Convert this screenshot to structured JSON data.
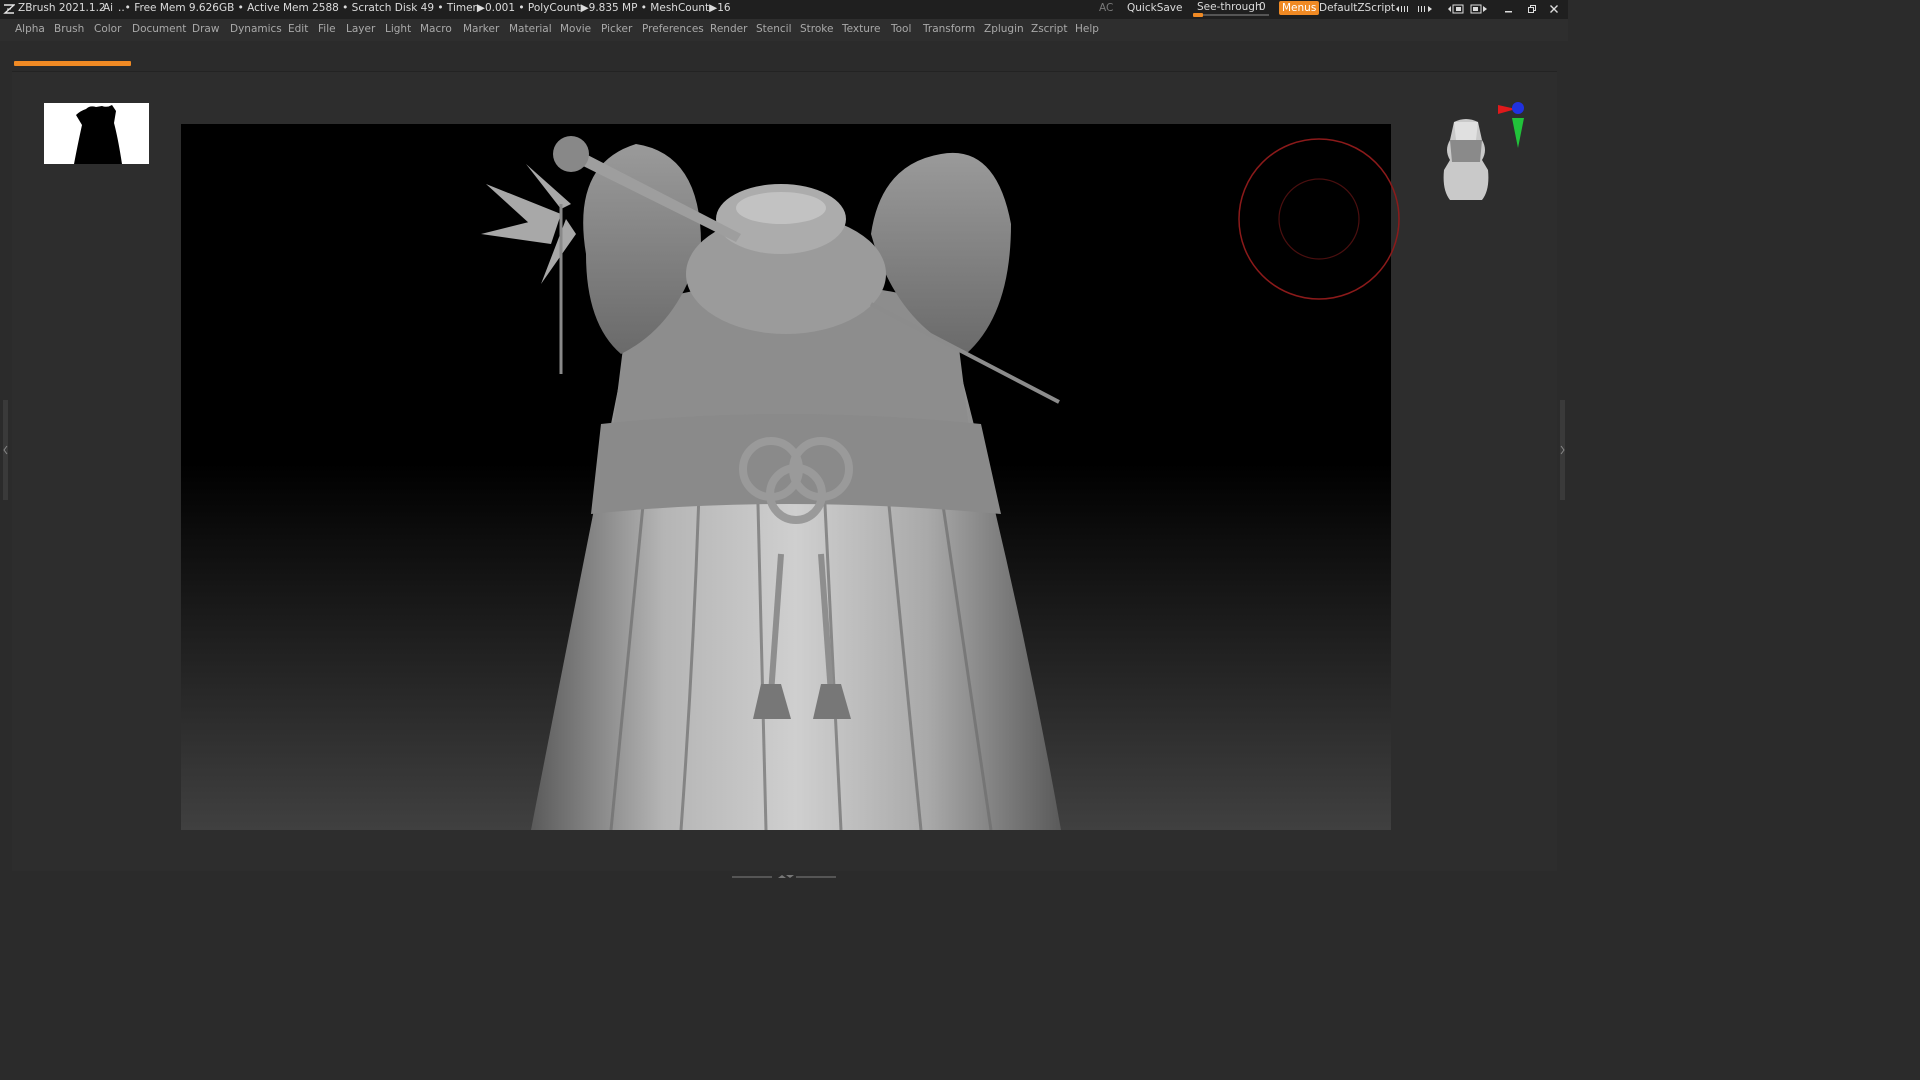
{
  "titlebar": {
    "app_title": "ZBrush 2021.1.2",
    "ai_label": "Ai",
    "status": "..• Free Mem 9.626GB • Active Mem 2588 • Scratch Disk 49 •  Timer▶0.001 • PolyCount▶9.835 MP  • MeshCount▶16",
    "ac_label": "AC",
    "quicksave_label": "QuickSave",
    "seethrough_label": "See-through",
    "seethrough_value": "0",
    "seethrough_level": 0.0,
    "menus_label": "Menus",
    "script_label": "DefaultZScript"
  },
  "menus": [
    "Alpha",
    "Brush",
    "Color",
    "Document",
    "Draw",
    "Dynamics",
    "Edit",
    "File",
    "Layer",
    "Light",
    "Macro",
    "Marker",
    "Material",
    "Movie",
    "Picker",
    "Preferences",
    "Render",
    "Stencil",
    "Stroke",
    "Texture",
    "Tool",
    "Transform",
    "Zplugin",
    "Zscript",
    "Help"
  ],
  "colors": {
    "accent_orange": "#f08a24",
    "axis_red": "#e0191b",
    "axis_green": "#21c23a",
    "axis_blue": "#2031e0",
    "brush_cursor": "#8b1a1a"
  },
  "icons": {
    "app": "zbrush-logo-icon",
    "layout_1": "layout-arrows-icon",
    "layout_2": "layout-arrows-icon",
    "layout_3": "window-layout-icon",
    "layout_4": "window-layout-icon",
    "minimize": "minimize-icon",
    "restore": "restore-icon",
    "close": "close-icon"
  }
}
